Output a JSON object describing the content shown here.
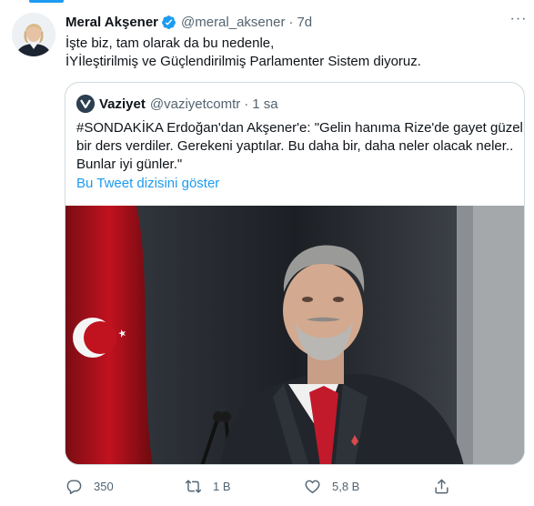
{
  "tweet": {
    "author_name": "Meral Akşener",
    "handle": "@meral_aksener",
    "separator": "·",
    "time": "7d",
    "text_lines": [
      "İşte biz, tam olarak da bu nedenle,",
      "İYİleştirilmiş ve Güçlendirilmiş Parlamenter Sistem diyoruz."
    ]
  },
  "quote": {
    "author_name": "Vaziyet",
    "handle": "@vaziyetcomtr",
    "separator": "·",
    "time": "1 sa",
    "text_lines": [
      "#SONDAKİKA Erdoğan'dan Akşener'e: \"Gelin hanıma Rize'de gayet güzel",
      "bir ders verdiler. Gerekeni yaptılar. Bu daha bir, daha neler olacak neler..",
      "Bunlar iyi günler.\""
    ],
    "thread_link": "Bu Tweet dizisini göster"
  },
  "actions": {
    "reply_count": "350",
    "retweet_count": "1 B",
    "like_count": "5,8 B"
  },
  "colors": {
    "accent": "#1d9bf0",
    "verified": "#1d9bf0",
    "muted_text": "#536471",
    "border": "#cfd9de"
  },
  "icons": {
    "verified": "verified-badge-icon",
    "reply": "reply-icon",
    "retweet": "retweet-icon",
    "like": "heart-icon",
    "share": "share-icon",
    "more": "more-icon"
  }
}
